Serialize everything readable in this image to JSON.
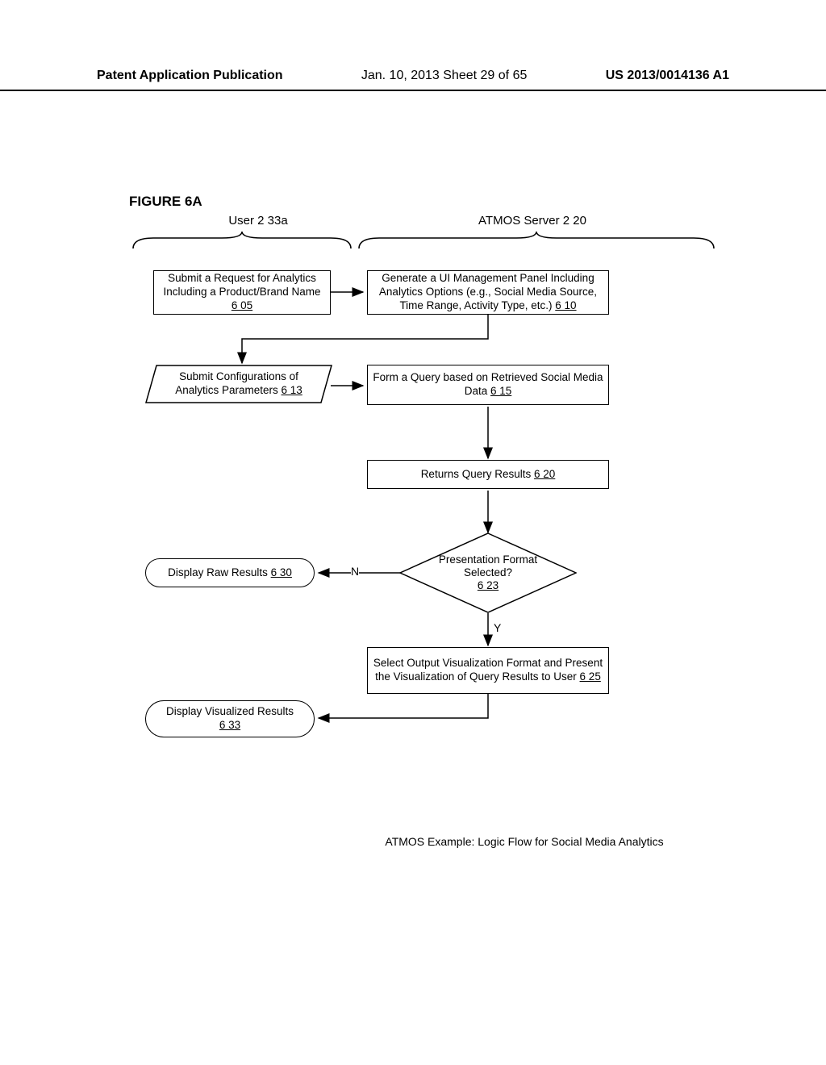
{
  "header": {
    "left": "Patent Application Publication",
    "center": "Jan. 10, 2013  Sheet 29 of 65",
    "right": "US 2013/0014136 A1"
  },
  "figure_title": "FIGURE 6A",
  "swimlanes": {
    "user": "User 2 33a",
    "server": "ATMOS Server 2 20"
  },
  "nodes": {
    "n605": {
      "text": "Submit a Request for Analytics Including a Product/Brand Name",
      "ref": "6 05"
    },
    "n610": {
      "text": "Generate a UI Management Panel Including Analytics Options (e.g., Social Media Source, Time Range, Activity Type, etc.)",
      "ref": "6 10"
    },
    "n613": {
      "text": "Submit Configurations of Analytics Parameters",
      "ref": "6 13"
    },
    "n615": {
      "text": "Form a Query based on Retrieved Social Media Data",
      "ref": "6 15"
    },
    "n620": {
      "text": "Returns Query Results",
      "ref": "6 20"
    },
    "n623": {
      "text": "Presentation Format Selected?",
      "ref": "6 23"
    },
    "n625": {
      "text": "Select Output Visualization Format and Present the Visualization of Query Results to User",
      "ref": "6 25"
    },
    "n630": {
      "text": "Display Raw Results",
      "ref": "6 30"
    },
    "n633": {
      "text": "Display Visualized Results",
      "ref": "6 33"
    }
  },
  "edge_labels": {
    "no": "N",
    "yes": "Y"
  },
  "caption": "ATMOS Example: Logic Flow for Social Media Analytics"
}
